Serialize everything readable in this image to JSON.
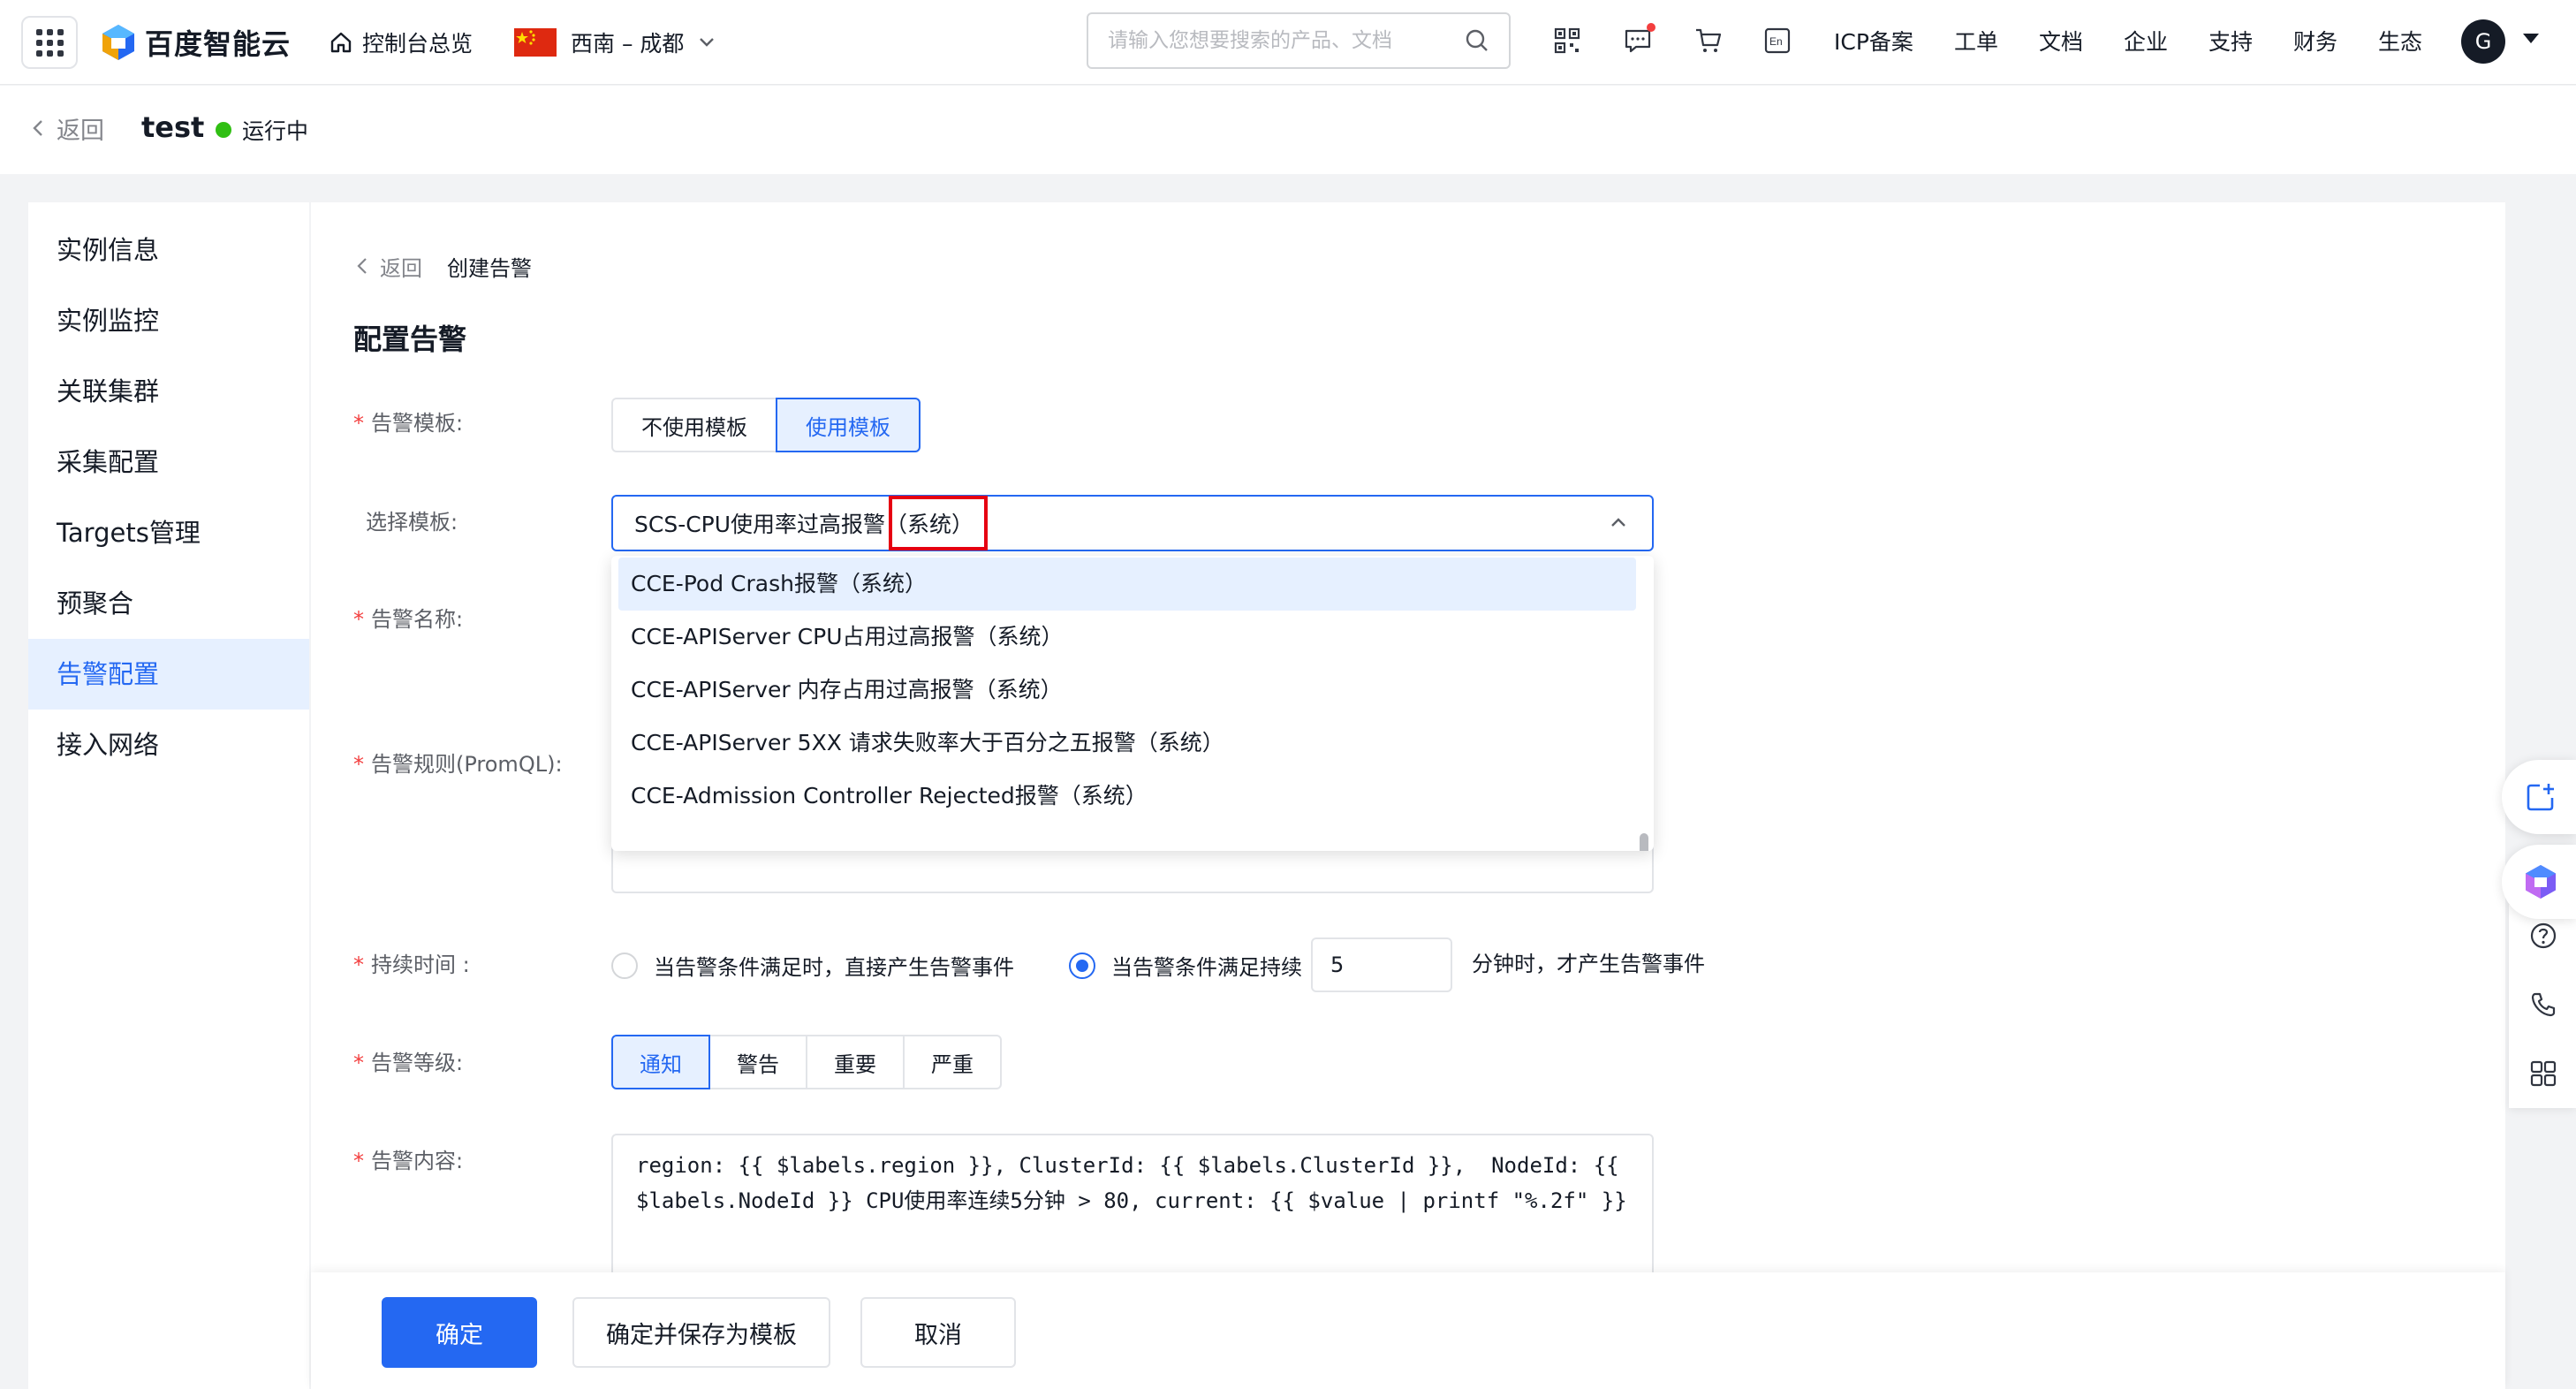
{
  "topbar": {
    "logo_text": "百度智能云",
    "console_home": "控制台总览",
    "region": "西南 – 成都",
    "search_placeholder": "请输入您想要搜索的产品、文档",
    "nav_links": [
      "ICP备案",
      "工单",
      "文档",
      "企业",
      "支持",
      "财务",
      "生态"
    ],
    "avatar_letter": "G"
  },
  "subheader": {
    "back_label": "返回",
    "instance_name": "test",
    "status_text": "运行中",
    "status_color": "#30bf13"
  },
  "sidebar": {
    "items": [
      {
        "label": "实例信息"
      },
      {
        "label": "实例监控"
      },
      {
        "label": "关联集群"
      },
      {
        "label": "采集配置"
      },
      {
        "label": "Targets管理"
      },
      {
        "label": "预聚合"
      },
      {
        "label": "告警配置",
        "active": true
      },
      {
        "label": "接入网络"
      }
    ]
  },
  "main": {
    "breadcrumb_back": "返回",
    "breadcrumb_current": "创建告警",
    "section_title": "配置告警",
    "labels": {
      "template": "告警模板:",
      "select_template": "选择模板:",
      "alert_name": "告警名称:",
      "alert_rule": "告警规则(PromQL):",
      "duration": "持续时间 :",
      "level": "告警等级:",
      "content": "告警内容:"
    },
    "template_buttons": [
      "不使用模板",
      "使用模板"
    ],
    "template_selected": 1,
    "select_value": "SCS-CPU使用率过高报警（系统）",
    "dropdown_options": [
      "CCE-Pod Crash报警（系统）",
      "CCE-APIServer CPU占用过高报警（系统）",
      "CCE-APIServer 内存占用过高报警（系统）",
      "CCE-APIServer 5XX 请求失败率大于百分之五报警（系统）",
      "CCE-Admission Controller Rejected报警（系统）"
    ],
    "dropdown_hover": 0,
    "duration": {
      "option_immediate": "当告警条件满足时，直接产生告警事件",
      "option_persist": "当告警条件满足持续",
      "minutes_value": "5",
      "suffix": "分钟时，才产生告警事件",
      "selected": "persist"
    },
    "levels": [
      "通知",
      "警告",
      "重要",
      "严重"
    ],
    "level_selected": 0,
    "content_text": "region: {{ $labels.region }}, ClusterId: {{ $labels.ClusterId }},  NodeId: {{ $labels.NodeId }} CPU使用率连续5分钟 > 80, current: {{ $value | printf \"%.2f\" }}"
  },
  "footer": {
    "confirm": "确定",
    "confirm_save": "确定并保存为模板",
    "cancel": "取消"
  },
  "colors": {
    "accent": "#2468f2",
    "highlight_box": "#e60012",
    "required": "#f33e3e"
  },
  "icons": {
    "topbar": [
      "app-grid-icon",
      "home-icon",
      "china-flag-icon",
      "chevron-down-icon",
      "search-icon",
      "qrcode-icon",
      "message-icon",
      "cart-icon",
      "language-icon"
    ],
    "floating": [
      "new-window-icon",
      "assistant-logo-icon",
      "help-icon",
      "phone-icon",
      "grid-apps-icon"
    ]
  }
}
